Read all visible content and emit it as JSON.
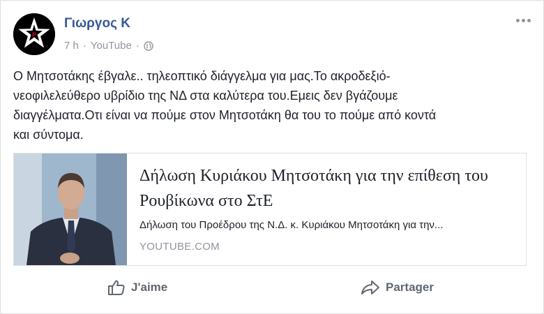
{
  "post": {
    "author": "Γιωργος Κ",
    "time": "7 h",
    "separator": "·",
    "source": "YouTube",
    "text": "Ο Μητσοτάκης έβγαλε.. τηλεοπτικό διάγγελμα για μας.Το ακροδεξιό-\nνεοφιλελεύθερο υβρίδιο της ΝΔ στα καλύτερα του.Εμεις δεν βγάζουμε\nδιαγγέλματα.Οτι είναι να πούμε στον Μητσοτάκη θα του το πούμε από κοντά\nκαι σύντομα."
  },
  "link_card": {
    "title": "Δήλωση Κυριάκου Μητσοτάκη για την επίθεση του Ρουβίκωνα στο ΣτΕ",
    "description": "Δήλωση του Προέδρου της Ν.Δ. κ. Κυριάκου Μητσοτάκη για την...",
    "domain": "YOUTUBE.COM"
  },
  "actions": {
    "like_label": "J'aime",
    "share_label": "Partager"
  },
  "colors": {
    "author_link": "#365899",
    "meta_gray": "#90949c",
    "action_gray": "#606770"
  },
  "icons": {
    "avatar": "red-star-p-logo",
    "audience": "globe-icon",
    "menu": "more-options-icon",
    "like": "thumbs-up-icon",
    "share": "share-arrow-icon"
  }
}
